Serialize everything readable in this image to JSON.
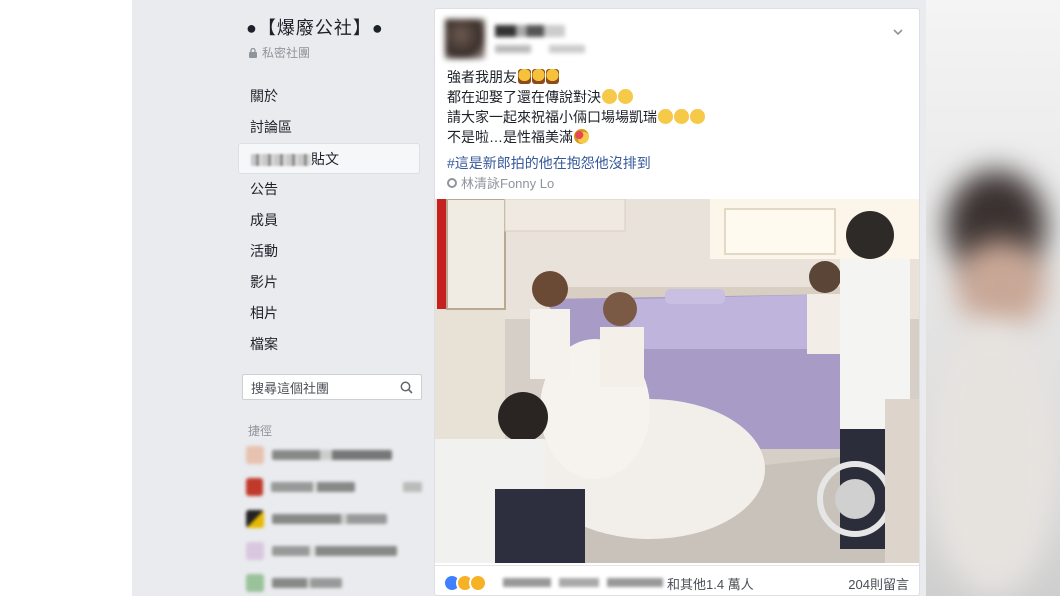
{
  "sidebar": {
    "group_title": "●【爆廢公社】●",
    "privacy_label": "私密社團",
    "nav": [
      {
        "label": "關於"
      },
      {
        "label": "討論區"
      },
      {
        "label": "貼文"
      },
      {
        "label": "公告"
      },
      {
        "label": "成員"
      },
      {
        "label": "活動"
      },
      {
        "label": "影片"
      },
      {
        "label": "相片"
      },
      {
        "label": "檔案"
      }
    ],
    "search_placeholder": "搜尋這個社團",
    "shortcuts_label": "捷徑"
  },
  "post": {
    "lines": [
      "強者我朋友",
      "都在迎娶了還在傳說對決",
      "請大家一起來祝福小倆口場場凱瑞",
      "不是啦…是性福美滿"
    ],
    "hashtag": "#這是新郎拍的他在抱怨他沒排到",
    "tag": "林清詠Fonny Lo",
    "reaction_count": "和其他1.4 萬人",
    "comment_count": "204則留言"
  },
  "colors": {
    "page_bg": "#e9ebee",
    "link": "#365899",
    "like": "#4080ff",
    "haha": "#f7b125"
  }
}
